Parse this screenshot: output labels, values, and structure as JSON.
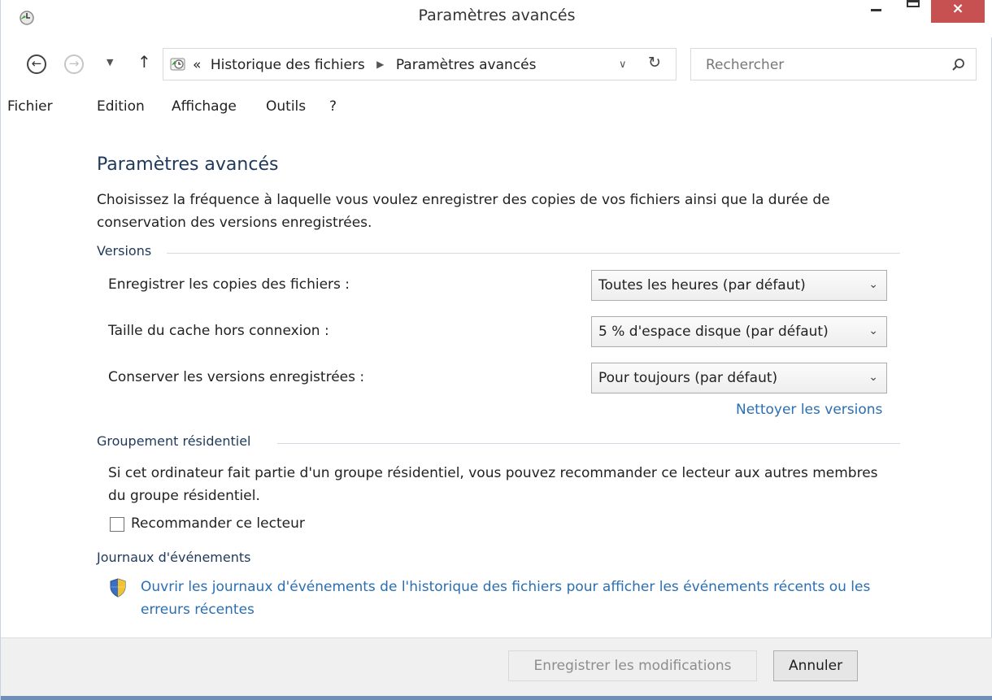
{
  "window": {
    "title": "Paramètres avancés",
    "close_label": "×",
    "accent_color": "#c75050"
  },
  "nav": {
    "back_label": "←",
    "forward_label": "→",
    "recent_label": "▼",
    "up_label": "↑",
    "breadcrumb_prefix": "«",
    "breadcrumb": [
      "Historique des fichiers",
      "Paramètres avancés"
    ],
    "breadcrumb_separator": "▶",
    "dropdown_label": "∨",
    "refresh_label": "↻",
    "search_placeholder": "Rechercher"
  },
  "menu": {
    "items": [
      "Fichier",
      "Edition",
      "Affichage",
      "Outils",
      "?"
    ]
  },
  "content": {
    "title": "Paramètres avancés",
    "intro": "Choisissez la fréquence à laquelle vous voulez enregistrer des copies de vos fichiers ainsi que la durée de conservation des versions enregistrées.",
    "versions": {
      "heading": "Versions",
      "rows": [
        {
          "label": "Enregistrer les copies des fichiers :",
          "value": "Toutes les heures (par défaut)"
        },
        {
          "label": "Taille du cache hors connexion :",
          "value": "5 % d'espace disque (par défaut)"
        },
        {
          "label": "Conserver les versions enregistrées :",
          "value": "Pour toujours (par défaut)"
        }
      ],
      "cleanup_link": "Nettoyer les versions"
    },
    "homegroup": {
      "heading": "Groupement résidentiel",
      "text": "Si cet ordinateur fait partie d'un groupe résidentiel, vous pouvez recommander ce lecteur aux autres membres du groupe résidentiel.",
      "checkbox_label": "Recommander ce lecteur",
      "checked": false
    },
    "events": {
      "heading": "Journaux d'événements",
      "link": "Ouvrir les journaux d'événements de l'historique des fichiers pour afficher les événements récents ou les erreurs récentes"
    }
  },
  "footer": {
    "save_label": "Enregistrer les modifications",
    "cancel_label": "Annuler"
  },
  "colors": {
    "heading": "#1e395b",
    "link": "#2a6fb3",
    "disabled_text": "#8d8d8d"
  },
  "combo_arrow": "⌄"
}
